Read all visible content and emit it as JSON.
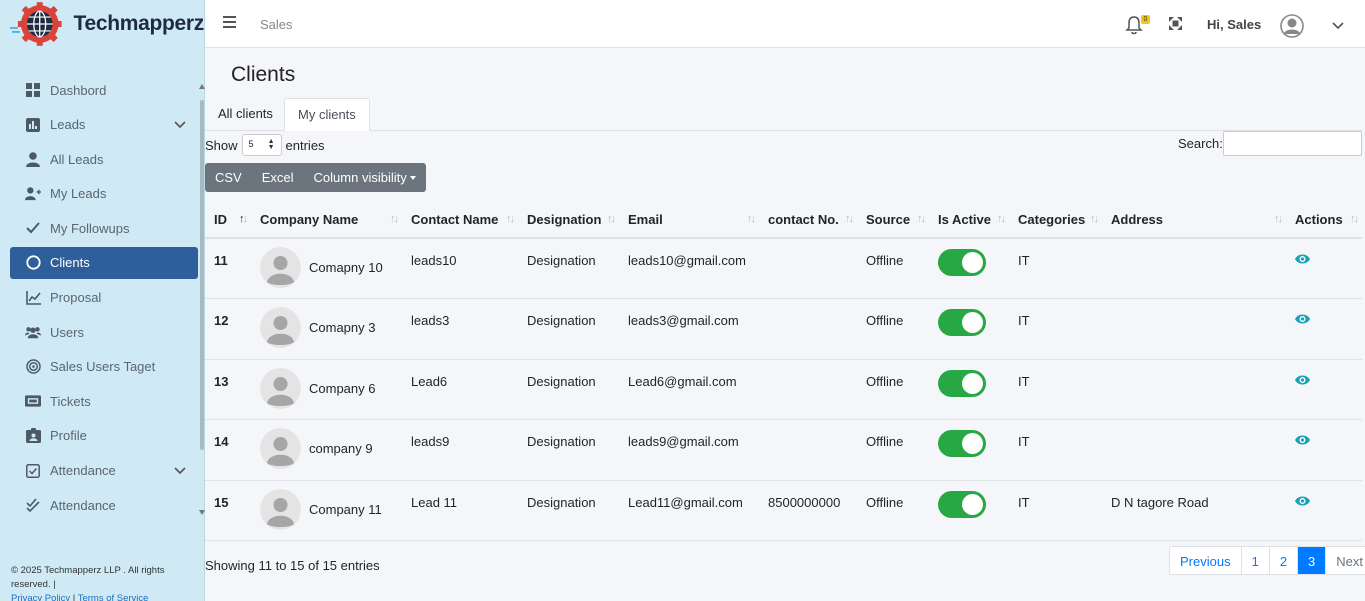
{
  "brand": {
    "name_a": "Tech",
    "name_b": "mapperz"
  },
  "sidebar": {
    "items": [
      {
        "label": "Dashbord",
        "icon": "dashboard-icon"
      },
      {
        "label": "Leads",
        "icon": "chart-icon"
      },
      {
        "label": "All Leads",
        "icon": "user-icon"
      },
      {
        "label": "My Leads",
        "icon": "user-plus-icon"
      },
      {
        "label": "My Followups",
        "icon": "check-icon"
      },
      {
        "label": "Clients",
        "icon": "circle-icon"
      },
      {
        "label": "Proposal",
        "icon": "line-chart-icon"
      },
      {
        "label": "Users",
        "icon": "users-icon"
      },
      {
        "label": "Sales Users Taget",
        "icon": "target-icon"
      },
      {
        "label": "Tickets",
        "icon": "ticket-icon"
      },
      {
        "label": "Profile",
        "icon": "id-card-icon"
      },
      {
        "label": "Attendance",
        "icon": "calendar-check-icon"
      },
      {
        "label": "Attendance",
        "icon": "double-check-icon"
      }
    ],
    "footer": {
      "copyright": "© 2025 Techmapperz LLP . All rights reserved. |",
      "privacy": "Privacy Policy",
      "sep": " | ",
      "terms": "Terms of Service"
    }
  },
  "topbar": {
    "breadcrumb": "Sales",
    "notif_count": "0",
    "greeting": "Hi, Sales"
  },
  "page": {
    "title": "Clients",
    "tabs": [
      "All clients",
      "My clients"
    ],
    "show": "Show",
    "entries_val": "5",
    "entries": "entries",
    "search_label": "Search:",
    "buttons": [
      "CSV",
      "Excel",
      "Column visibility"
    ],
    "info": "Showing 11 to 15 of 15 entries",
    "pager": [
      "Previous",
      "1",
      "2",
      "3",
      "Next"
    ]
  },
  "table": {
    "headers": [
      "ID",
      "Company Name",
      "Contact Name",
      "Designation",
      "Email",
      "contact No.",
      "Source",
      "Is Active",
      "Categories",
      "Address",
      "Actions"
    ],
    "rows": [
      {
        "id": "11",
        "company": "Comapny 10",
        "contact": "leads10",
        "designation": "Designation",
        "email": "leads10@gmail.com",
        "phone": "",
        "source": "Offline",
        "category": "IT",
        "address": ""
      },
      {
        "id": "12",
        "company": "Comapny 3",
        "contact": "leads3",
        "designation": "Designation",
        "email": "leads3@gmail.com",
        "phone": "",
        "source": "Offline",
        "category": "IT",
        "address": ""
      },
      {
        "id": "13",
        "company": "Company 6",
        "contact": "Lead6",
        "designation": "Designation",
        "email": "Lead6@gmail.com",
        "phone": "",
        "source": "Offline",
        "category": "IT",
        "address": ""
      },
      {
        "id": "14",
        "company": "company 9",
        "contact": "leads9",
        "designation": "Designation",
        "email": "leads9@gmail.com",
        "phone": "",
        "source": "Offline",
        "category": "IT",
        "address": ""
      },
      {
        "id": "15",
        "company": "Company 11",
        "contact": "Lead 11",
        "designation": "Designation",
        "email": "Lead11@gmail.com",
        "phone": "8500000000",
        "source": "Offline",
        "category": "IT",
        "address": "D N tagore Road"
      }
    ]
  },
  "colors": {
    "sidebar_bg": "#cfeaf5",
    "active": "#2f5f9b",
    "toggle": "#28a745",
    "eye": "#17a2b8",
    "link": "#007bff"
  }
}
